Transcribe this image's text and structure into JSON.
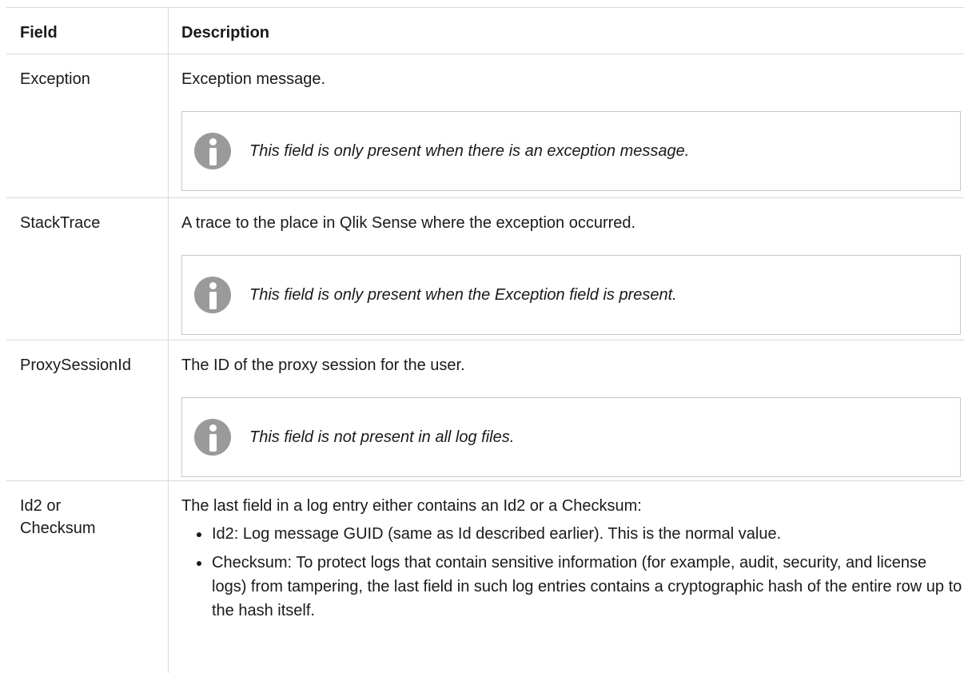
{
  "table": {
    "headers": {
      "field": "Field",
      "description": "Description"
    },
    "rows": [
      {
        "field": "Exception",
        "description": "Exception message.",
        "note": "This field is only present when there is an exception message."
      },
      {
        "field": "StackTrace",
        "description": "A trace to the place in Qlik Sense where the exception occurred.",
        "note": "This field is only present when the Exception field is present."
      },
      {
        "field": "ProxySessionId",
        "description": "The ID of the proxy session for the user.",
        "note": "This field is not present in all log files."
      },
      {
        "field_line1": "Id2 or",
        "field_line2": "Checksum",
        "description": "The last field in a log entry either contains an Id2 or a Checksum:",
        "bullets": [
          "Id2: Log message GUID (same as Id described earlier). This is the normal value.",
          "Checksum: To protect logs that contain sensitive information (for example, audit, security, and license logs) from tampering, the last field in such log entries contains a cryptographic hash of the entire row up to the hash itself."
        ]
      }
    ]
  },
  "icons": {
    "note": "info-icon"
  },
  "colors": {
    "border": "#d9d9d9",
    "icon": "#9a9a9a",
    "text": "#1a1a1a"
  }
}
